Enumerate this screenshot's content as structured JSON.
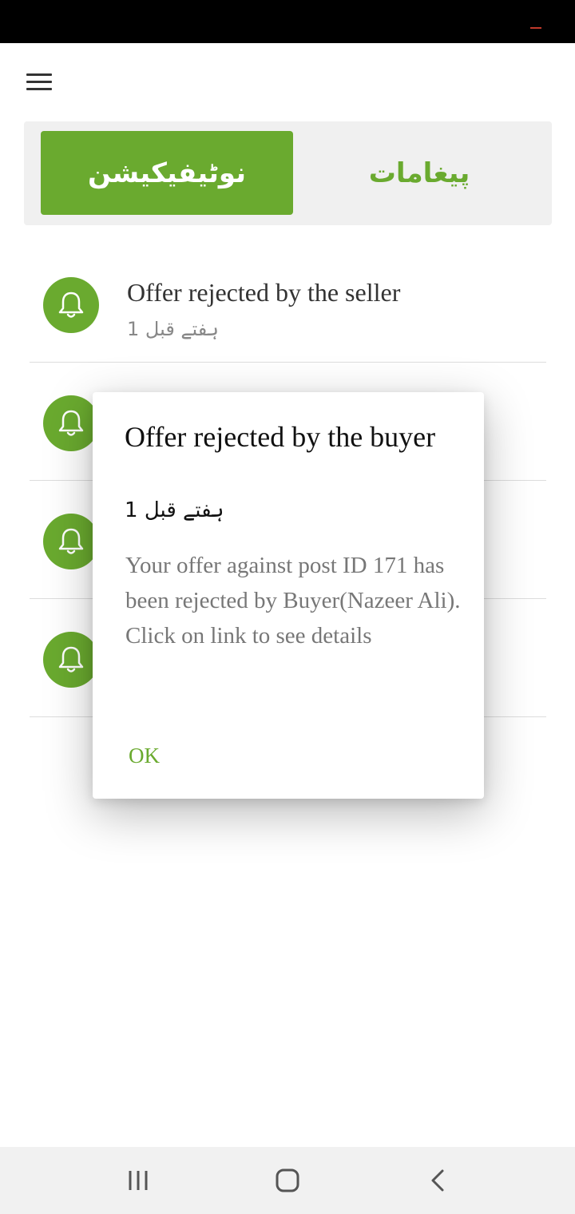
{
  "status_bar": {
    "indicator_color": "#c0392b"
  },
  "header": {
    "menu_icon": "hamburger-menu-icon"
  },
  "tabs": [
    {
      "label": "نوٹیفیکیشن",
      "active": true
    },
    {
      "label": "پیغامات",
      "active": false
    }
  ],
  "notifications": [
    {
      "title": "Offer rejected by the seller",
      "time": "1 ہفتے قبل",
      "icon": "bell-icon"
    },
    {
      "title": "",
      "time": "",
      "icon": "bell-icon"
    },
    {
      "title": "",
      "time": "",
      "icon": "bell-icon"
    },
    {
      "title": "",
      "time": "",
      "icon": "bell-icon"
    }
  ],
  "dialog": {
    "title": "Offer rejected by the buyer",
    "time": "1 ہفتے قبل",
    "body": "Your offer against post ID 171 has been rejected by Buyer(Nazeer Ali). Click on link to see details",
    "ok_label": "OK"
  },
  "nav_bar": {
    "buttons": [
      "recent-apps-icon",
      "home-icon",
      "back-icon"
    ]
  },
  "colors": {
    "accent": "#6aaa2f",
    "tab_bg": "#f0f0f0"
  }
}
